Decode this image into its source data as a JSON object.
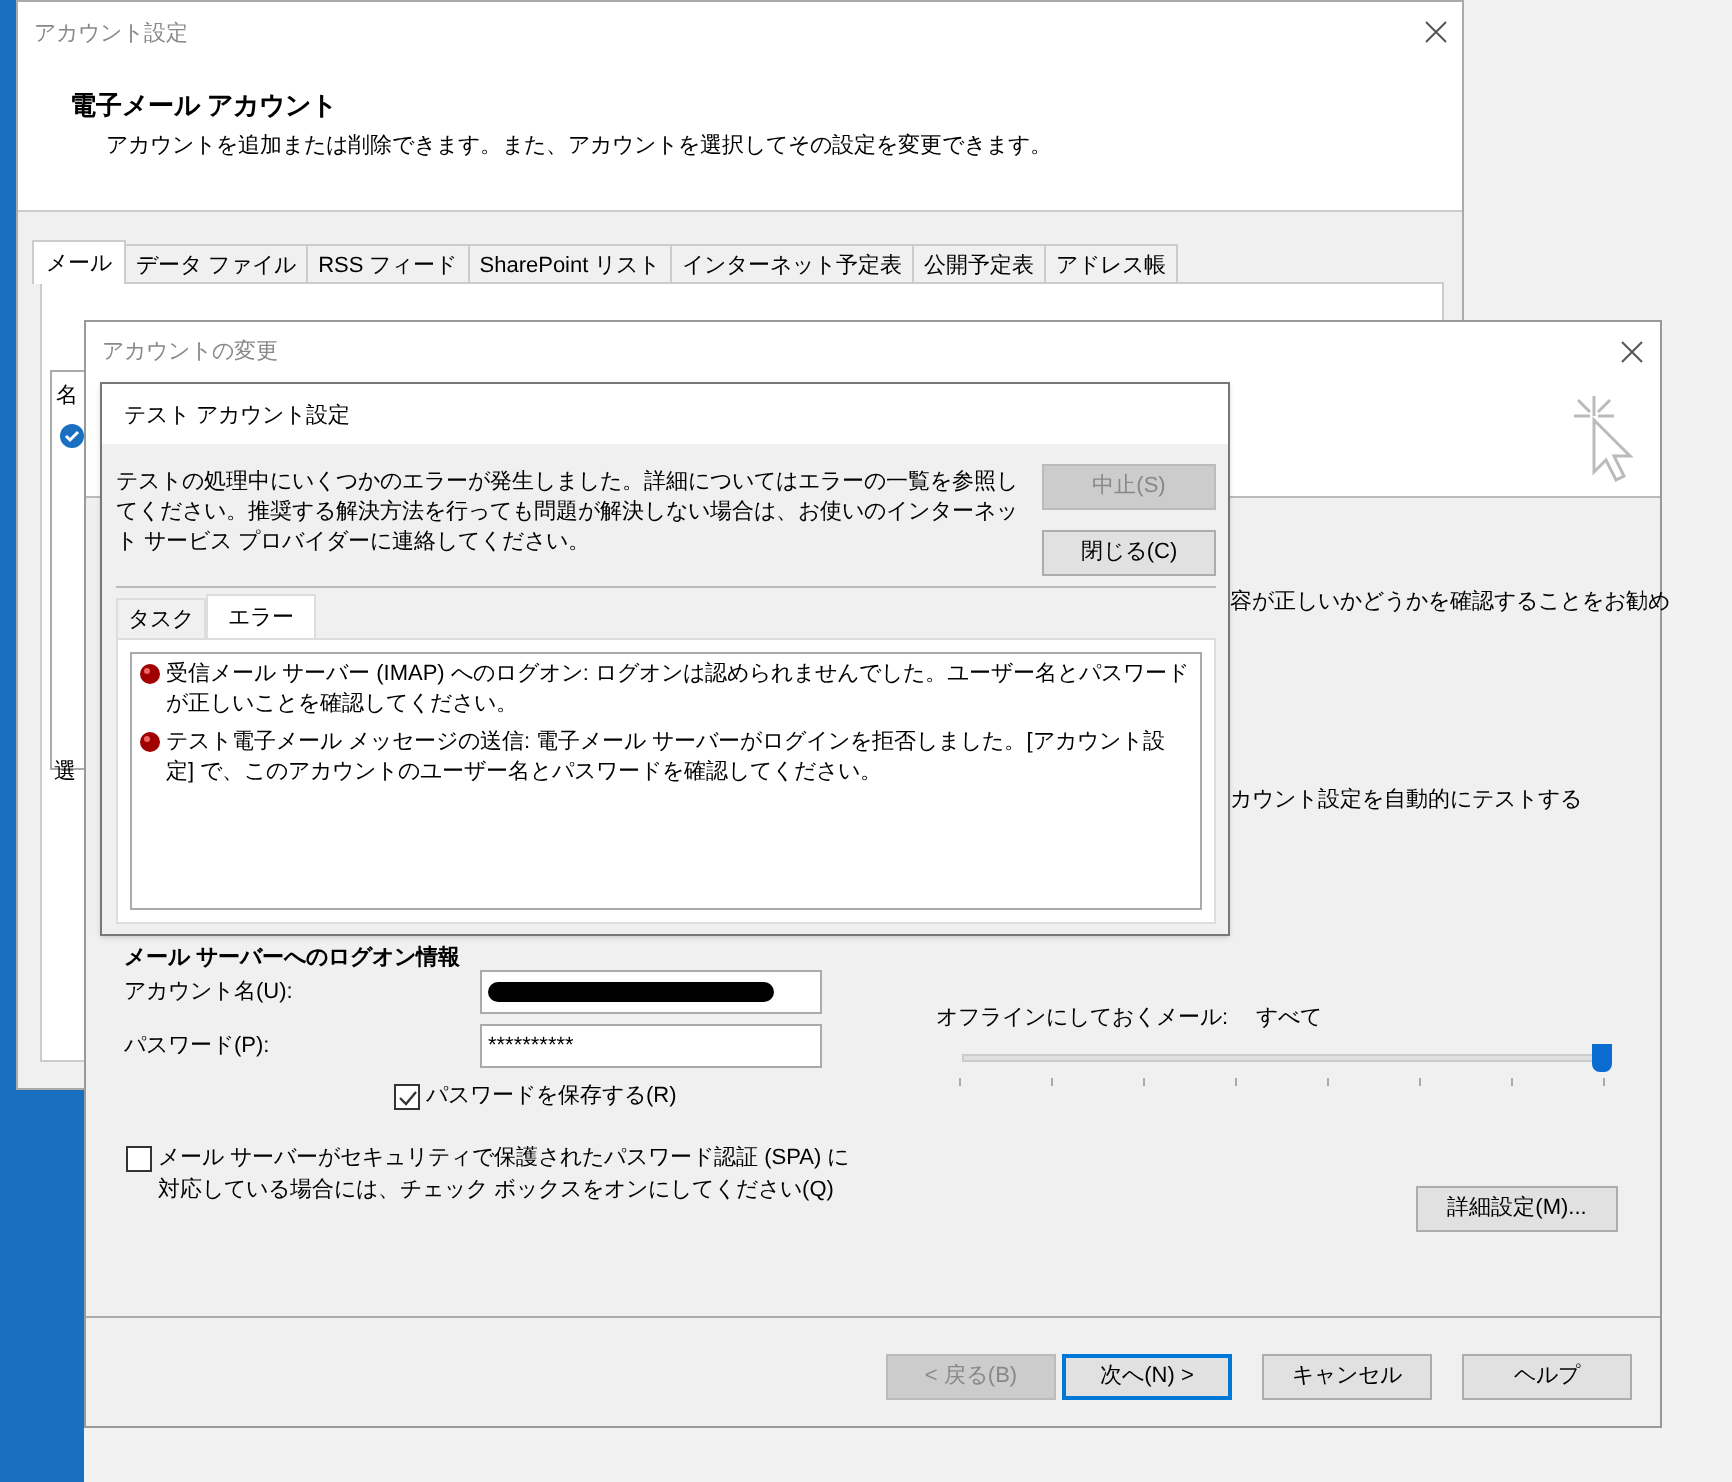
{
  "account_settings_window": {
    "title": "アカウント設定",
    "heading": "電子メール アカウント",
    "description": "アカウントを追加または削除できます。また、アカウントを選択してその設定を変更できます。",
    "tabs": [
      {
        "label": "メール",
        "selected": true
      },
      {
        "label": "データ ファイル",
        "selected": false
      },
      {
        "label": "RSS フィード",
        "selected": false
      },
      {
        "label": "SharePoint リスト",
        "selected": false
      },
      {
        "label": "インターネット予定表",
        "selected": false
      },
      {
        "label": "公開予定表",
        "selected": false
      },
      {
        "label": "アドレス帳",
        "selected": false
      }
    ],
    "column_header": "名",
    "side_fragment": "選"
  },
  "change_account_window": {
    "title": "アカウントの変更",
    "intro_fragment": "容が正しいかどうかを確認することをお勧め",
    "test_fragment": "カウント設定を自動的にテストする",
    "logon_section_title": "メール サーバーへのログオン情報",
    "account_name_label": "アカウント名(U):",
    "password_label": "パスワード(P):",
    "password_value": "**********",
    "save_password": {
      "label": "パスワードを保存する(R)",
      "checked": true
    },
    "spa": {
      "label": "メール サーバーがセキュリティで保護されたパスワード認証 (SPA) に対応している場合には、チェック ボックスをオンにしてください(Q)",
      "checked": false
    },
    "offline_label": "オフラインにしておくメール:",
    "offline_value": "すべて",
    "offline_slider": {
      "level": 1
    },
    "advanced_button": "詳細設定(M)...",
    "buttons": [
      {
        "label": "< 戻る(B)",
        "disabled": true,
        "focused": false
      },
      {
        "label": "次へ(N) >",
        "disabled": false,
        "focused": true
      },
      {
        "label": "キャンセル",
        "disabled": false,
        "focused": false
      },
      {
        "label": "ヘルプ",
        "disabled": false,
        "focused": false
      }
    ]
  },
  "test_dialog": {
    "title": "テスト アカウント設定",
    "message": "テストの処理中にいくつかのエラーが発生しました。詳細についてはエラーの一覧を参照してください。推奨する解決方法を行っても問題が解決しない場合は、お使いのインターネット サービス プロバイダーに連絡してください。",
    "buttons": [
      {
        "label": "中止(S)",
        "disabled": true
      },
      {
        "label": "閉じる(C)",
        "disabled": false
      }
    ],
    "tabs": [
      {
        "label": "タスク",
        "selected": false
      },
      {
        "label": "エラー",
        "selected": true
      }
    ],
    "errors": [
      {
        "text": "受信メール サーバー (IMAP) へのログオン: ログオンは認められませんでした。ユーザー名とパスワードが正しいことを確認してください。"
      },
      {
        "text": "テスト電子メール メッセージの送信: 電子メール サーバーがログインを拒否しました。[アカウント設定] で、このアカウントのユーザー名とパスワードを確認してください。"
      }
    ]
  }
}
